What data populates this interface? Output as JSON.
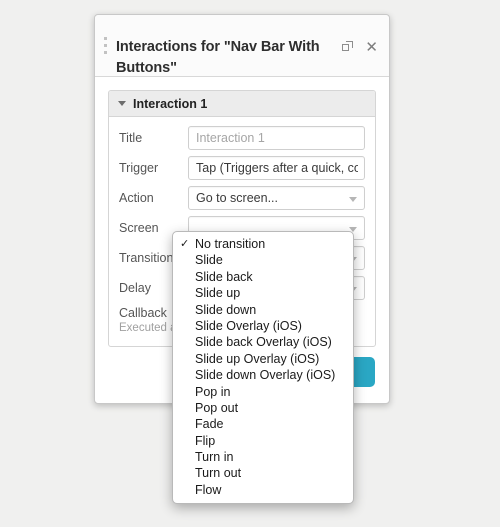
{
  "window": {
    "title": "Interactions for \"Nav Bar With Buttons\"",
    "drag_handle_icon": "drag-dots-icon",
    "popout_icon": "popout-icon",
    "close_icon": "close-icon"
  },
  "section": {
    "caret_icon": "caret-down-icon",
    "title": "Interaction 1"
  },
  "form": {
    "rows": [
      {
        "label": "Title",
        "value": "Interaction 1",
        "is_placeholder": true,
        "type": "text"
      },
      {
        "label": "Trigger",
        "value": "Tap (Triggers after a quick, comple",
        "is_placeholder": false,
        "type": "text"
      },
      {
        "label": "Action",
        "value": "Go to screen...",
        "is_placeholder": false,
        "type": "select"
      },
      {
        "label": "Screen",
        "value": "",
        "is_placeholder": false,
        "type": "select"
      },
      {
        "label": "Transition",
        "value": "",
        "is_placeholder": false,
        "type": "select"
      },
      {
        "label": "Delay",
        "value": "",
        "is_placeholder": false,
        "type": "select"
      }
    ],
    "callback_label": "Callback",
    "callback_help": "Executed af"
  },
  "action_button": {
    "label": ""
  },
  "dropdown": {
    "selected": "No transition",
    "check_glyph": "✓",
    "options": [
      "No transition",
      "Slide",
      "Slide back",
      "Slide up",
      "Slide down",
      "Slide Overlay (iOS)",
      "Slide back Overlay (iOS)",
      "Slide up Overlay (iOS)",
      "Slide down Overlay (iOS)",
      "Pop in",
      "Pop out",
      "Fade",
      "Flip",
      "Turn in",
      "Turn out",
      "Flow"
    ]
  },
  "colors": {
    "accent_teal": "#2aa7c4",
    "page_background": "#f0f0ef",
    "panel_background": "#ffffff",
    "section_header": "#ececec"
  }
}
